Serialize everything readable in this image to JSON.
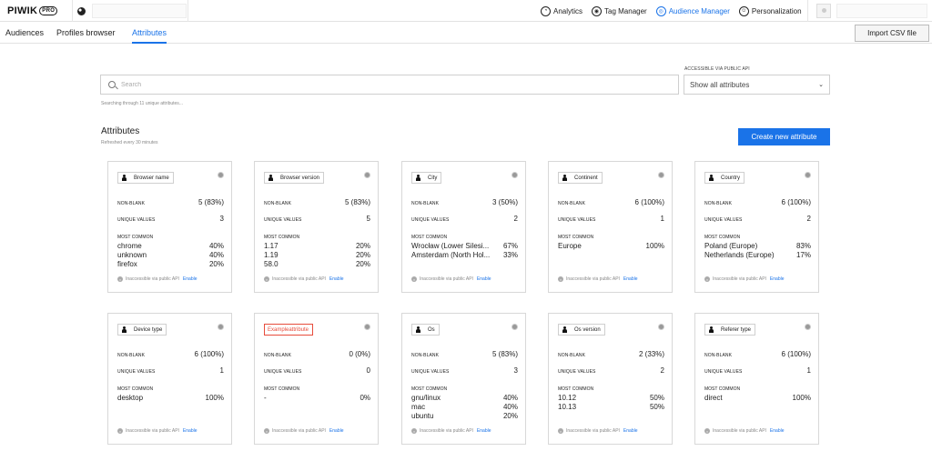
{
  "topbar": {
    "logo": "PIWIK",
    "logo_badge": "PRO",
    "modules": [
      {
        "label": "Analytics",
        "icon": "analytics-icon"
      },
      {
        "label": "Tag Manager",
        "icon": "tag-manager-icon"
      },
      {
        "label": "Audience Manager",
        "icon": "audience-manager-icon",
        "active": true
      },
      {
        "label": "Personalization",
        "icon": "personalization-icon"
      }
    ]
  },
  "subnav": {
    "tabs": [
      {
        "label": "Audiences"
      },
      {
        "label": "Profiles browser"
      },
      {
        "label": "Attributes",
        "active": true
      }
    ],
    "import_label": "Import CSV file"
  },
  "search": {
    "placeholder": "Search",
    "hint": "Searching through 11 unique attributes..."
  },
  "api_filter": {
    "label": "ACCESSIBLE VIA PUBLIC API",
    "value": "Show all attributes"
  },
  "section": {
    "title": "Attributes",
    "subtitle": "Refreshed every 30 minutes",
    "create_label": "Create new attribute"
  },
  "labels": {
    "non_blank": "NON-BLANK",
    "unique_values": "UNIQUE VALUES",
    "most_common": "MOST COMMON",
    "inaccessible": "Inaccessible via public API",
    "enable": "Enable"
  },
  "colors": {
    "accent": "#1a73e8",
    "error": "#e74c3c"
  },
  "cards": [
    {
      "name": "Browser name",
      "non_blank": "5 (83%)",
      "unique": "3",
      "most_common": [
        {
          "v": "chrome",
          "p": "40%"
        },
        {
          "v": "unknown",
          "p": "40%"
        },
        {
          "v": "firefox",
          "p": "20%"
        }
      ]
    },
    {
      "name": "Browser version",
      "non_blank": "5 (83%)",
      "unique": "5",
      "most_common": [
        {
          "v": "1.17",
          "p": "20%"
        },
        {
          "v": "1.19",
          "p": "20%"
        },
        {
          "v": "58.0",
          "p": "20%"
        }
      ]
    },
    {
      "name": "City",
      "non_blank": "3 (50%)",
      "unique": "2",
      "most_common": [
        {
          "v": "Wrocław (Lower Silesi...",
          "p": "67%"
        },
        {
          "v": "Amsterdam (North Hol...",
          "p": "33%"
        }
      ]
    },
    {
      "name": "Continent",
      "non_blank": "6 (100%)",
      "unique": "1",
      "most_common": [
        {
          "v": "Europe",
          "p": "100%"
        }
      ]
    },
    {
      "name": "Country",
      "non_blank": "6 (100%)",
      "unique": "2",
      "most_common": [
        {
          "v": "Poland (Europe)",
          "p": "83%"
        },
        {
          "v": "Netherlands (Europe)",
          "p": "17%"
        }
      ]
    },
    {
      "name": "Device type",
      "non_blank": "6 (100%)",
      "unique": "1",
      "most_common": [
        {
          "v": "desktop",
          "p": "100%"
        }
      ]
    },
    {
      "name": "Exampleattribute",
      "invalid": true,
      "non_blank": "0 (0%)",
      "unique": "0",
      "most_common": [
        {
          "v": "-",
          "p": "0%"
        }
      ]
    },
    {
      "name": "Os",
      "non_blank": "5 (83%)",
      "unique": "3",
      "most_common": [
        {
          "v": "gnu/linux",
          "p": "40%"
        },
        {
          "v": "mac",
          "p": "40%"
        },
        {
          "v": "ubuntu",
          "p": "20%"
        }
      ]
    },
    {
      "name": "Os version",
      "non_blank": "2 (33%)",
      "unique": "2",
      "most_common": [
        {
          "v": "10.12",
          "p": "50%"
        },
        {
          "v": "10.13",
          "p": "50%"
        }
      ]
    },
    {
      "name": "Referer type",
      "non_blank": "6 (100%)",
      "unique": "1",
      "most_common": [
        {
          "v": "direct",
          "p": "100%"
        }
      ]
    }
  ]
}
